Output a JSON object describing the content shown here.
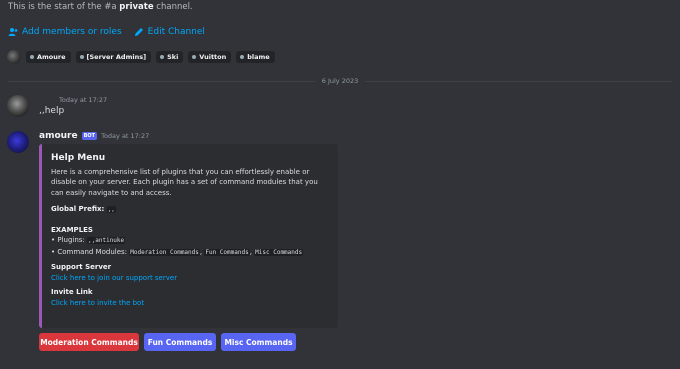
{
  "channel_start": {
    "prefix": "This is the start of the #a ",
    "bold": "private",
    "suffix": " channel."
  },
  "actions": {
    "add_members": "Add members or roles",
    "edit_channel": "Edit Channel"
  },
  "roles": [
    "Amoure",
    "[Server Admins]",
    "Ski",
    "Vuitton",
    "blame"
  ],
  "date_divider": "6 July 2023",
  "message1": {
    "time": "Today at 17:27",
    "text": ",,help"
  },
  "message2": {
    "username": "amoure",
    "bot_tag": "BOT",
    "time": "Today at 17:27",
    "embed": {
      "accent": "#9b59b6",
      "title": "Help Menu",
      "description": "Here is a comprehensive list of plugins that you can effortlessly enable or disable on your server. Each plugin has a set of command modules that you can easily navigate to and access.",
      "global_prefix_label": "Global Prefix:",
      "global_prefix_value": ",,",
      "examples_label": "EXAMPLES",
      "plugins_label": "• Plugins: ",
      "plugins_value": ",,antinuke",
      "modules_label": "• Command Modules: ",
      "modules": [
        "Moderation Commands",
        "Fun Commands",
        "Misc Commands"
      ],
      "support_label": "Support Server",
      "support_link": "Click here to join our support server",
      "invite_label": "Invite Link",
      "invite_link": "Click here to invite the bot"
    }
  },
  "buttons": {
    "moderation": "Moderation Commands",
    "fun": "Fun Commands",
    "misc": "Misc Commands"
  },
  "colors": {
    "background": "#313338",
    "link": "#00a8fc",
    "danger": "#da373c",
    "blurple": "#5865f2"
  }
}
